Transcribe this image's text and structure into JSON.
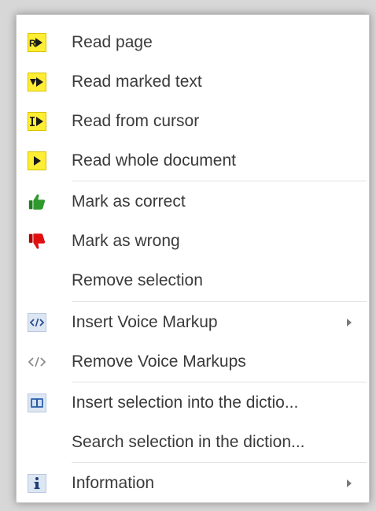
{
  "menu": {
    "items": [
      {
        "label": "Read page",
        "icon": "read-page-icon"
      },
      {
        "label": "Read marked text",
        "icon": "read-marked-text-icon"
      },
      {
        "label": "Read from cursor",
        "icon": "read-from-cursor-icon"
      },
      {
        "label": "Read whole document",
        "icon": "read-whole-document-icon"
      },
      {
        "label": "Mark as correct",
        "icon": "thumbs-up-icon"
      },
      {
        "label": "Mark as wrong",
        "icon": "thumbs-down-icon"
      },
      {
        "label": "Remove selection"
      },
      {
        "label": "Insert Voice Markup",
        "icon": "voice-markup-icon",
        "submenu": true
      },
      {
        "label": "Remove Voice Markups",
        "icon": "remove-markup-icon"
      },
      {
        "label": "Insert selection into the dictio...",
        "icon": "dictionary-icon"
      },
      {
        "label": "Search selection in the diction..."
      },
      {
        "label": "Information",
        "icon": "info-icon",
        "submenu": true
      }
    ]
  },
  "colors": {
    "play_yellow": "#ffee33",
    "thumbs_up_green": "#2e9a2e",
    "thumbs_down_red": "#e01010",
    "text": "#3a3a3a"
  }
}
